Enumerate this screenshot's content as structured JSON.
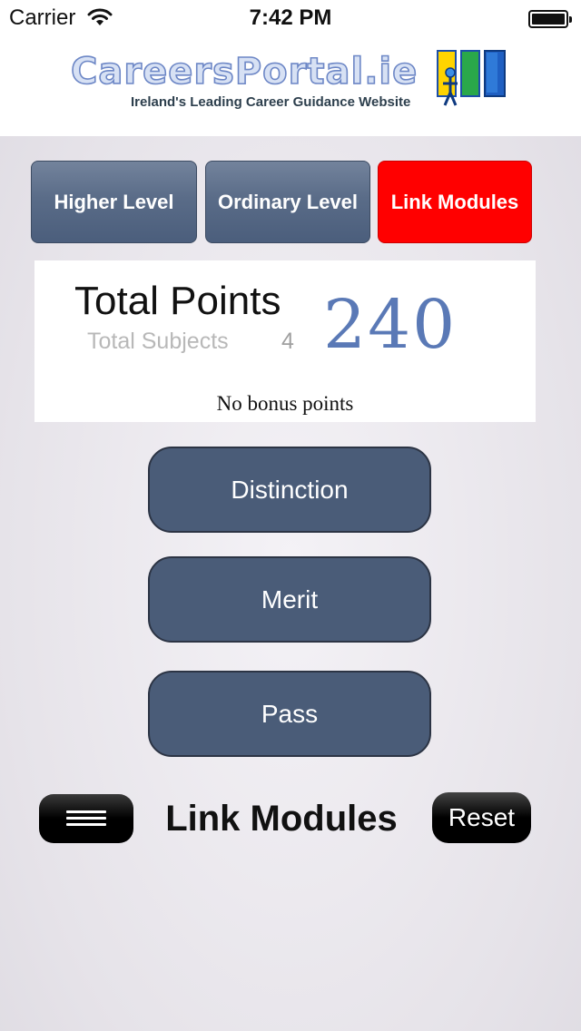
{
  "status_bar": {
    "carrier": "Carrier",
    "time": "7:42 PM"
  },
  "header": {
    "logo_text": "CareersPortal.ie",
    "tagline": "Ireland's Leading Career Guidance Website"
  },
  "level_tabs": [
    {
      "label": "Higher Level",
      "selected": false
    },
    {
      "label": "Ordinary Level",
      "selected": false
    },
    {
      "label": "Link Modules",
      "selected": true
    }
  ],
  "points_panel": {
    "title": "Total Points",
    "subjects_label": "Total Subjects",
    "subjects_count": "4",
    "total_points": "240",
    "bonus_text": "No bonus points"
  },
  "grade_buttons": {
    "distinction": "Distinction",
    "merit": "Merit",
    "pass": "Pass"
  },
  "footer": {
    "title": "Link Modules",
    "reset_label": "Reset",
    "menu_icon": "hamburger-menu-icon"
  },
  "colors": {
    "selected_tab": "#ff0000",
    "tab": "#5a6c88",
    "grade_button": "#4a5c78",
    "points_value": "#5a79b6"
  }
}
